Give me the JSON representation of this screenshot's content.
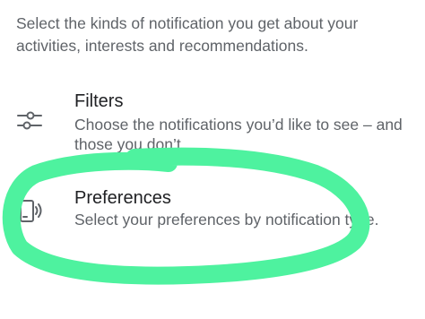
{
  "intro_text": "Select the kinds of notification you get about your activities, interests and recommendations.",
  "items": [
    {
      "icon": "sliders-icon",
      "title": "Filters",
      "description": "Choose the notifications you’d like to see – and those you don’t."
    },
    {
      "icon": "phone-vibrate-icon",
      "title": "Preferences",
      "description": "Select your preferences by notification type."
    }
  ],
  "annotation": {
    "color": "#4ef29f"
  }
}
